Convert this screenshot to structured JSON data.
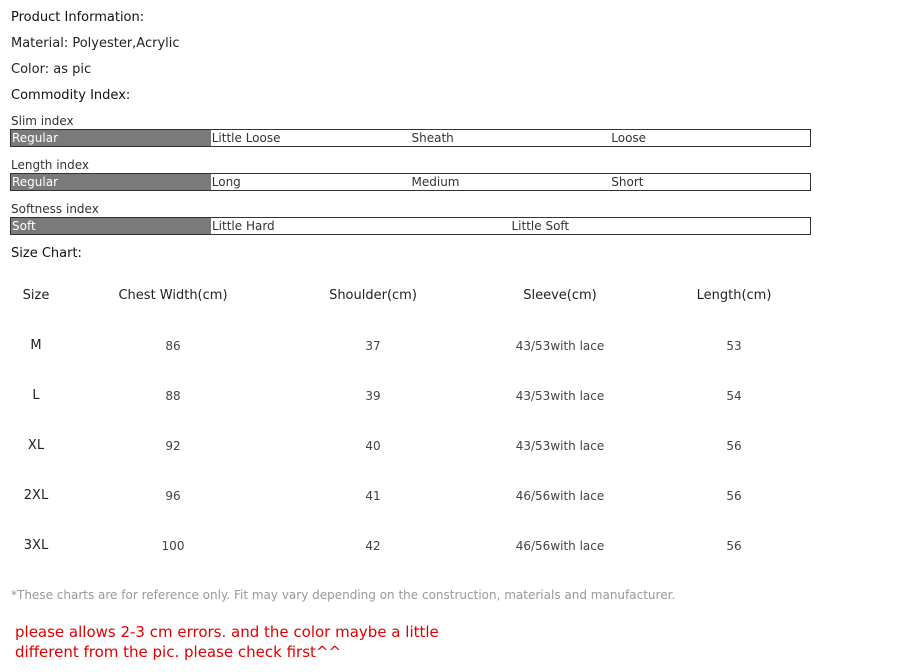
{
  "product_info": {
    "heading": "Product Information:",
    "material": "Material: Polyester,Acrylic",
    "color": "Color: as pic"
  },
  "commodity": {
    "heading": "Commodity Index:",
    "slim": {
      "label": "Slim index",
      "options": [
        "Regular",
        "Little Loose",
        "Sheath",
        "Loose"
      ],
      "selected": "Regular"
    },
    "length": {
      "label": "Length index",
      "options": [
        "Regular",
        "Long",
        "Medium",
        "Short"
      ],
      "selected": "Regular"
    },
    "softness": {
      "label": "Softness index",
      "options": [
        "Soft",
        "Little Hard",
        "Little Soft"
      ],
      "selected": "Soft"
    },
    "selected_color": "#7a7a7a"
  },
  "size_chart": {
    "heading": "Size Chart:",
    "columns": [
      "Size",
      "Chest Width(cm)",
      "Shoulder(cm)",
      "Sleeve(cm)",
      "Length(cm)"
    ],
    "rows": [
      [
        "M",
        "86",
        "37",
        "43/53with lace",
        "53"
      ],
      [
        "L",
        "88",
        "39",
        "43/53with lace",
        "54"
      ],
      [
        "XL",
        "92",
        "40",
        "43/53with lace",
        "56"
      ],
      [
        "2XL",
        "96",
        "41",
        "46/56with lace",
        "56"
      ],
      [
        "3XL",
        "100",
        "42",
        "46/56with lace",
        "56"
      ]
    ]
  },
  "footnote": "*These charts are for reference only. Fit may vary depending on the construction, materials and manufacturer.",
  "warning": "please allows 2-3 cm errors. and the color maybe a little different from the pic. please check first^^",
  "warning_color": "#e00000"
}
